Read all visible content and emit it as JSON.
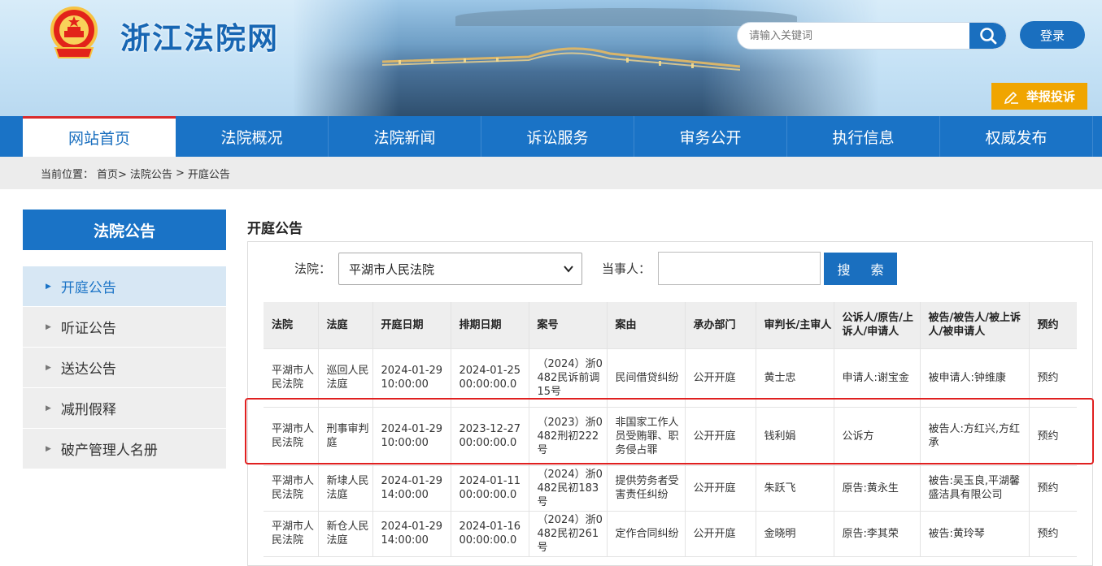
{
  "site": {
    "title": "浙江法院网"
  },
  "search": {
    "placeholder": "请输入关键词",
    "icon": "search-icon"
  },
  "header": {
    "login_label": "登录",
    "report_label": "举报投诉"
  },
  "nav": {
    "items": [
      {
        "label": "网站首页",
        "active": true
      },
      {
        "label": "法院概况"
      },
      {
        "label": "法院新闻"
      },
      {
        "label": "诉讼服务"
      },
      {
        "label": "审务公开"
      },
      {
        "label": "执行信息"
      },
      {
        "label": "权威发布"
      }
    ]
  },
  "breadcrumb": {
    "prefix": "当前位置：",
    "items": [
      "首页>",
      "法院公告",
      ">",
      "开庭公告"
    ]
  },
  "sidebar": {
    "title": "法院公告",
    "items": [
      {
        "label": "开庭公告",
        "active": true
      },
      {
        "label": "听证公告"
      },
      {
        "label": "送达公告"
      },
      {
        "label": "减刑假释"
      },
      {
        "label": "破产管理人名册"
      }
    ]
  },
  "content": {
    "title": "开庭公告",
    "court_label": "法院：",
    "court_selected": "平湖市人民法院",
    "party_label": "当事人：",
    "party_value": "",
    "search_button": "搜 索"
  },
  "table": {
    "headers": [
      "法院",
      "法庭",
      "开庭日期",
      "排期日期",
      "案号",
      "案由",
      "承办部门",
      "审判长/主审人",
      "公诉人/原告/上诉人/申请人",
      "被告/被告人/被上诉人/被申请人",
      "预约"
    ],
    "rows": [
      [
        "平湖市人民法院",
        "巡回人民法庭",
        "2024-01-29 10:00:00",
        "2024-01-25 00:00:00.0",
        "（2024）浙0482民诉前调15号",
        "民间借贷纠纷",
        "公开开庭",
        "黄士忠",
        "申请人:谢宝金",
        "被申请人:钟维康",
        "预约"
      ],
      [
        "平湖市人民法院",
        "刑事审判庭",
        "2024-01-29 10:00:00",
        "2023-12-27 00:00:00.0",
        "（2023）浙0482刑初222号",
        "非国家工作人员受贿罪、职务侵占罪",
        "公开开庭",
        "钱利娟",
        "公诉方",
        "被告人:方红兴,方红承",
        "预约"
      ],
      [
        "平湖市人民法院",
        "新埭人民法庭",
        "2024-01-29 14:00:00",
        "2024-01-11 00:00:00.0",
        "（2024）浙0482民初183号",
        "提供劳务者受害责任纠纷",
        "公开开庭",
        "朱跃飞",
        "原告:黄永生",
        "被告:吴玉良,平湖馨盛洁具有限公司",
        "预约"
      ],
      [
        "平湖市人民法院",
        "新仓人民法庭",
        "2024-01-29 14:00:00",
        "2024-01-16 00:00:00.0",
        "（2024）浙0482民初261号",
        "定作合同纠纷",
        "公开开庭",
        "金晓明",
        "原告:李其荣",
        "被告:黄玲琴",
        "预约"
      ]
    ]
  },
  "colors": {
    "brand": "#1a73c6",
    "accent_red": "#d92b2b",
    "report": "#f0a500"
  }
}
